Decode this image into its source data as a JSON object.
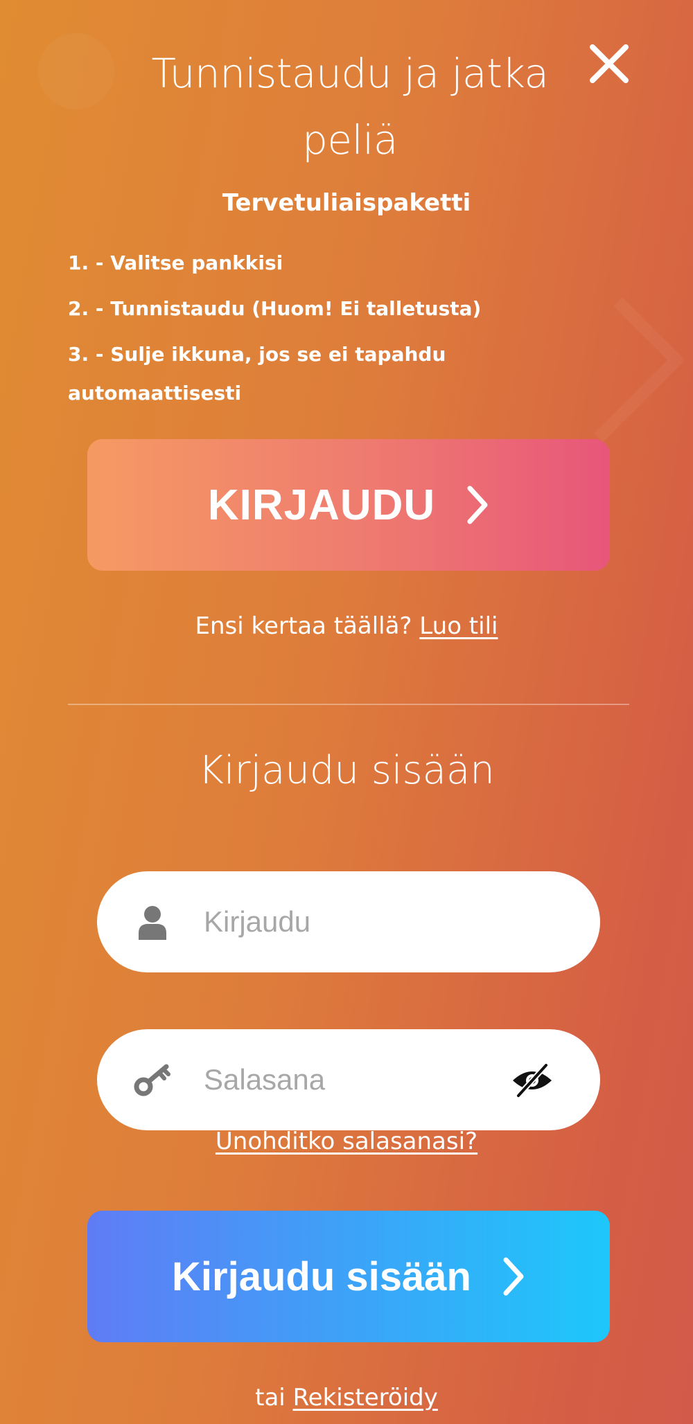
{
  "header": {
    "title": "Tunnistaudu ja jatka peliä",
    "close_icon": "close-icon"
  },
  "welcome": {
    "package_title": "Tervetuliaispaketti",
    "steps": [
      "1. - Valitse pankkisi",
      "2. - Tunnistaudu (Huom! Ei talletusta)",
      "3. - Sulje ikkuna, jos se ei tapahdu automaattisesti"
    ],
    "login_button": "KIRJAUDU",
    "first_time_text": "Ensi kertaa täällä?",
    "create_account_link": "Luo tili"
  },
  "login": {
    "title": "Kirjaudu sisään",
    "username": {
      "placeholder": "Kirjaudu",
      "value": "",
      "icon": "user-icon"
    },
    "password": {
      "placeholder": "Salasana",
      "value": "",
      "icon": "key-icon",
      "toggle_icon": "eye-slash-icon"
    },
    "forgot_link": "Unohditko salasanasi?",
    "submit_button": "Kirjaudu sisään",
    "or_text": "tai",
    "register_link": "Rekisteröidy"
  },
  "colors": {
    "background_start": "#e08c33",
    "background_end": "#d15a4a",
    "kirjaudu_button_start": "#f59a63",
    "kirjaudu_button_end": "#e8567a",
    "signin_button_start": "#5f7cf5",
    "signin_button_end": "#1ec7fb",
    "field_background": "#ffffff",
    "placeholder_text": "#a7a7a7"
  }
}
